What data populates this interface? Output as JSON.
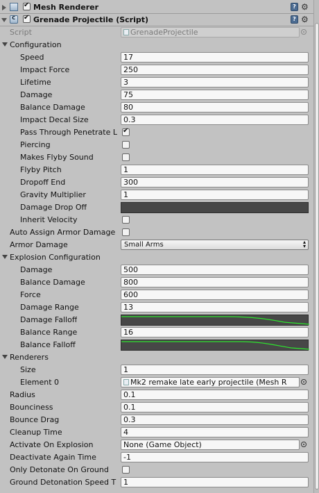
{
  "mesh_renderer": {
    "title": "Mesh Renderer",
    "enabled": true
  },
  "script_component": {
    "title": "Grenade Projectile (Script)",
    "enabled": true
  },
  "script_field": {
    "label": "Script",
    "value": "GrenadeProjectile"
  },
  "configuration": {
    "label": "Configuration",
    "speed": {
      "label": "Speed",
      "value": "17"
    },
    "impact_force": {
      "label": "Impact Force",
      "value": "250"
    },
    "lifetime": {
      "label": "Lifetime",
      "value": "3"
    },
    "damage": {
      "label": "Damage",
      "value": "75"
    },
    "balance_damage": {
      "label": "Balance Damage",
      "value": "80"
    },
    "impact_decal_size": {
      "label": "Impact Decal Size",
      "value": "0.3"
    },
    "pass_through": {
      "label": "Pass Through Penetrate L",
      "checked": true
    },
    "piercing": {
      "label": "Piercing",
      "checked": false
    },
    "makes_flyby_sound": {
      "label": "Makes Flyby Sound",
      "checked": false
    },
    "flyby_pitch": {
      "label": "Flyby Pitch",
      "value": "1"
    },
    "dropoff_end": {
      "label": "Dropoff End",
      "value": "300"
    },
    "gravity_multiplier": {
      "label": "Gravity Multiplier",
      "value": "1"
    },
    "damage_drop_off": {
      "label": "Damage Drop Off"
    },
    "inherit_velocity": {
      "label": "Inherit Velocity",
      "checked": false
    }
  },
  "auto_assign_armor_damage": {
    "label": "Auto Assign Armor Damage",
    "checked": false
  },
  "armor_damage": {
    "label": "Armor Damage",
    "value": "Small Arms"
  },
  "explosion": {
    "label": "Explosion Configuration",
    "damage": {
      "label": "Damage",
      "value": "500"
    },
    "balance_damage": {
      "label": "Balance Damage",
      "value": "800"
    },
    "force": {
      "label": "Force",
      "value": "600"
    },
    "damage_range": {
      "label": "Damage Range",
      "value": "13"
    },
    "damage_falloff": {
      "label": "Damage Falloff"
    },
    "balance_range": {
      "label": "Balance Range",
      "value": "16"
    },
    "balance_falloff": {
      "label": "Balance Falloff"
    }
  },
  "renderers": {
    "label": "Renderers",
    "size": {
      "label": "Size",
      "value": "1"
    },
    "element0": {
      "label": "Element 0",
      "value": "Mk2 remake late early projectile (Mesh R"
    }
  },
  "radius": {
    "label": "Radius",
    "value": "0.1"
  },
  "bounciness": {
    "label": "Bounciness",
    "value": "0.1"
  },
  "bounce_drag": {
    "label": "Bounce Drag",
    "value": "0.3"
  },
  "cleanup_time": {
    "label": "Cleanup Time",
    "value": "4"
  },
  "activate_on_explosion": {
    "label": "Activate On Explosion",
    "value": "None (Game Object)"
  },
  "deactivate_again_time": {
    "label": "Deactivate Again Time",
    "value": "-1"
  },
  "only_detonate_on_ground": {
    "label": "Only Detonate On Ground",
    "checked": false
  },
  "ground_detonation_speed": {
    "label": "Ground Detonation Speed T",
    "value": "1"
  },
  "colors": {
    "curve_bg": "#474747",
    "curve_line": "#2ee62e",
    "panel_bg": "#c2c2c2"
  },
  "icons": [
    "mesh-renderer-icon",
    "script-icon",
    "help-icon",
    "gear-icon",
    "object-picker-icon"
  ]
}
